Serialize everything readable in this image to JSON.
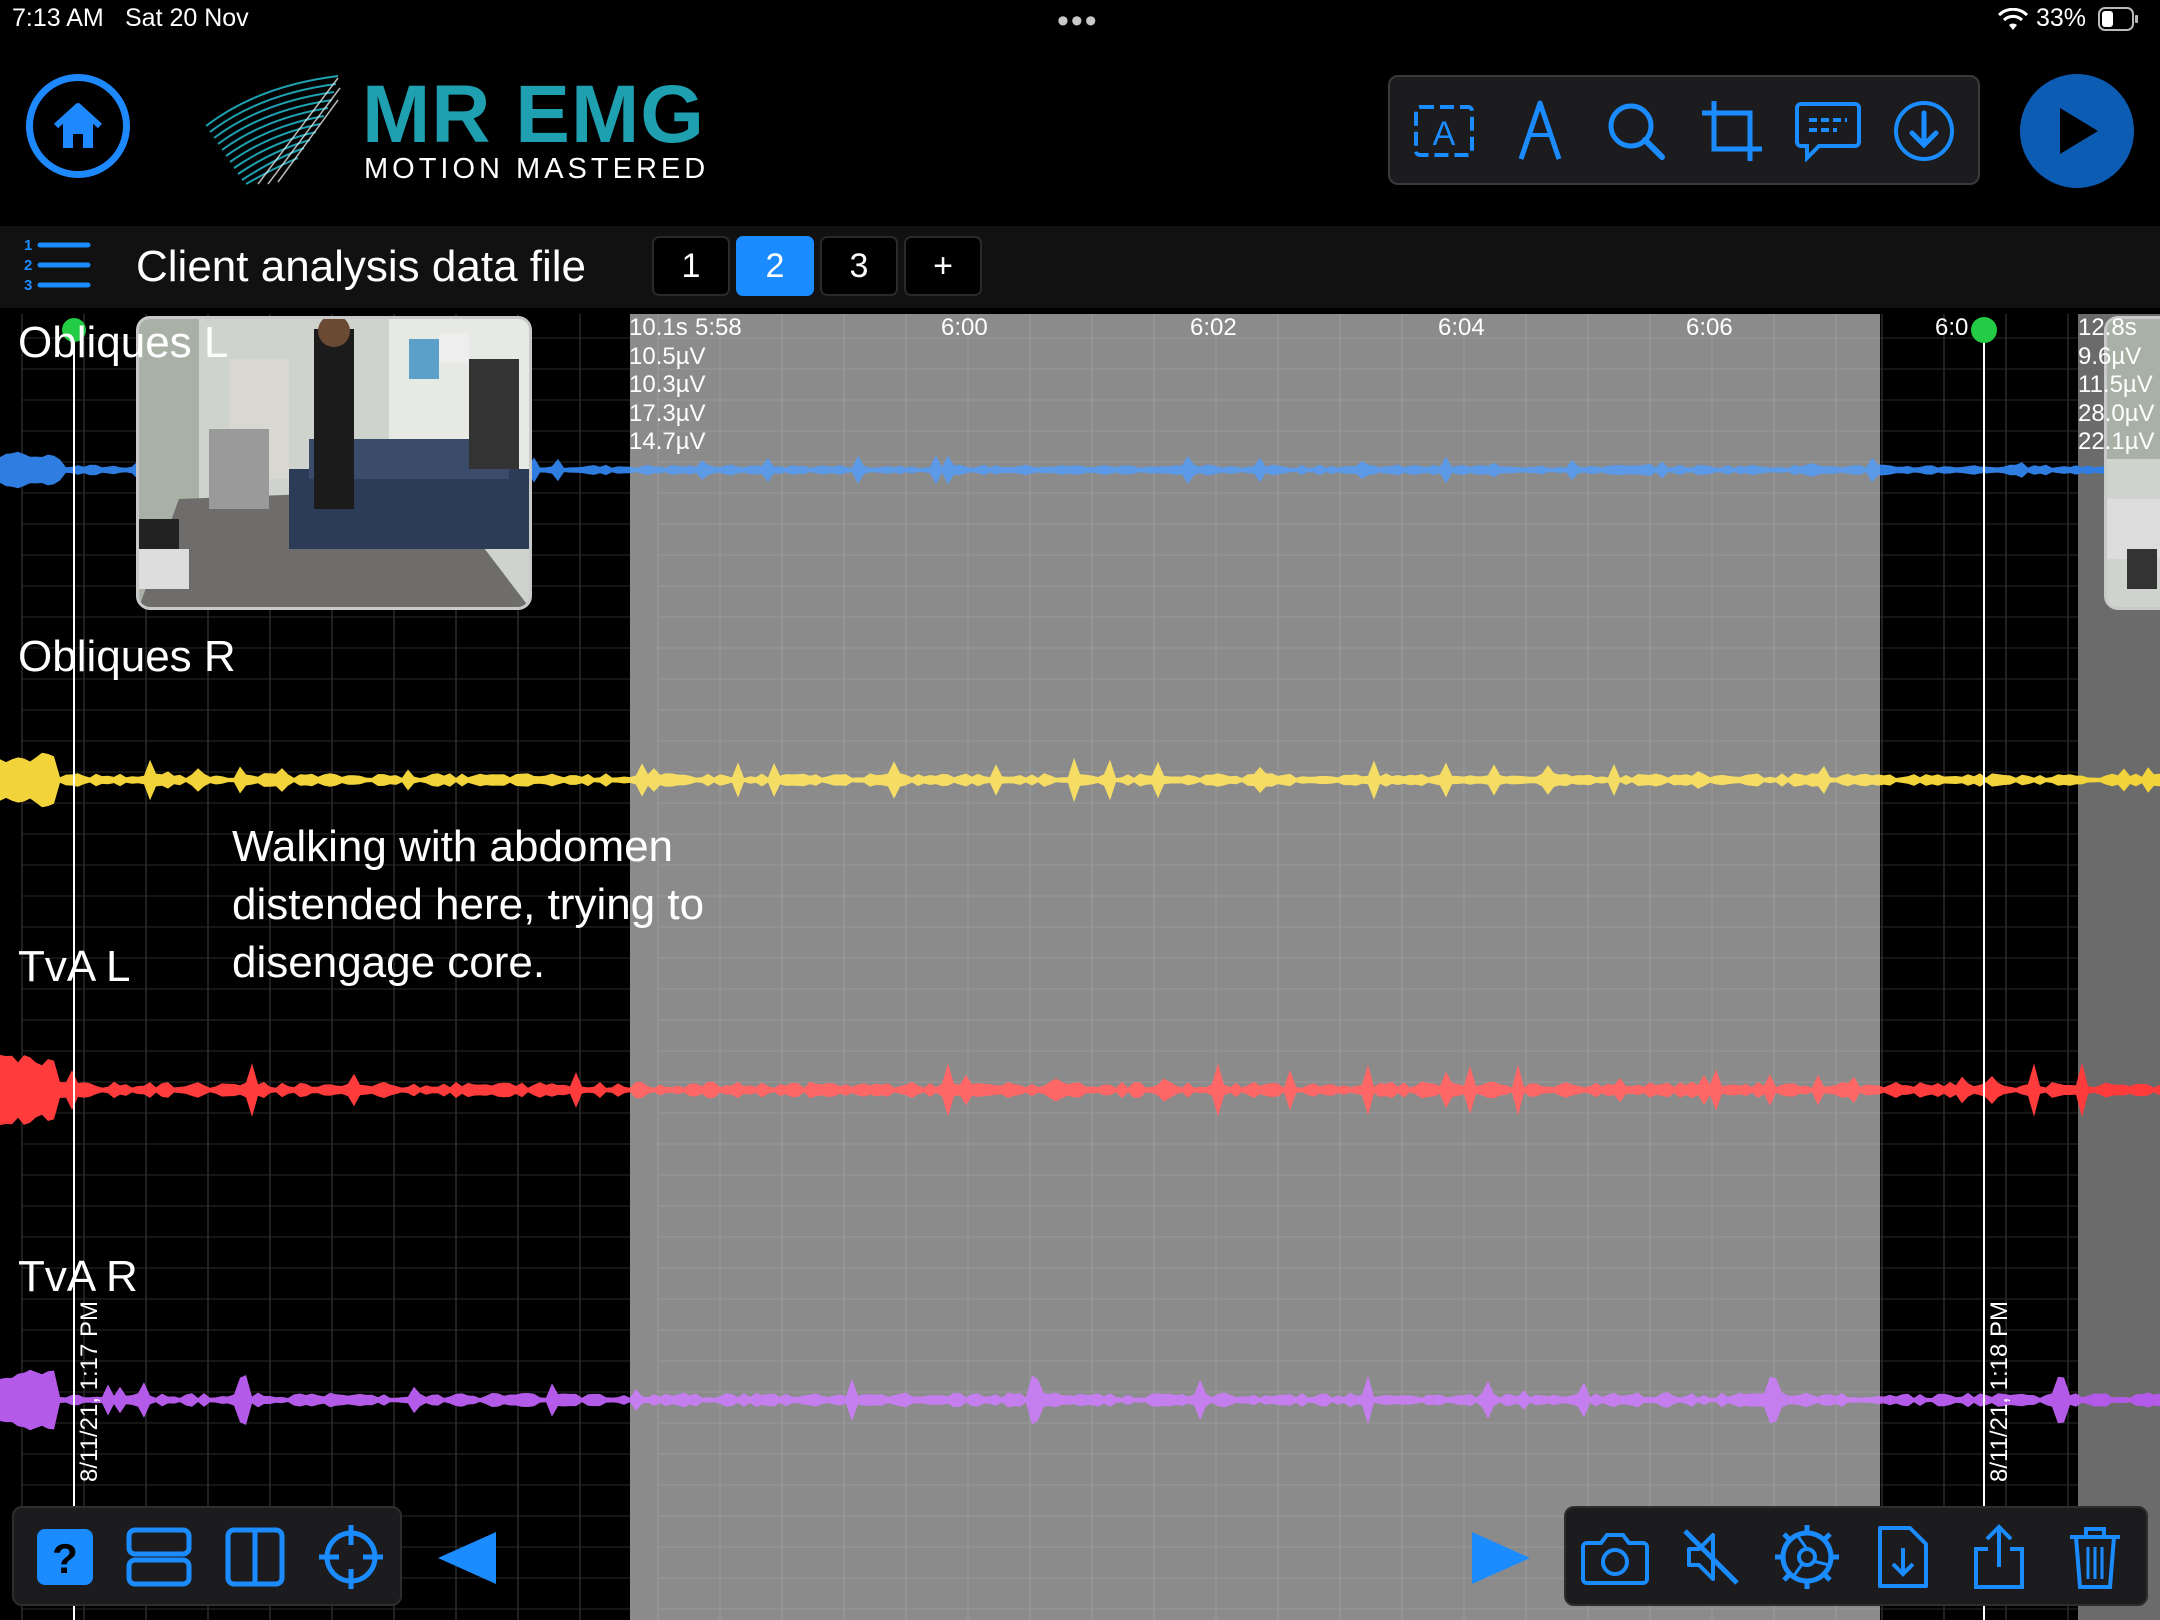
{
  "status_bar": {
    "time": "7:13 AM",
    "date": "Sat 20 Nov",
    "battery": "33%",
    "dots": "•••"
  },
  "brand": {
    "name": "MR EMG",
    "tagline": "MOTION MASTERED"
  },
  "header_tools": [
    "text-box-icon",
    "pen-icon",
    "search-icon",
    "crop-icon",
    "comment-icon",
    "download-icon"
  ],
  "file": {
    "title": "Client analysis data file",
    "pages": [
      "1",
      "2",
      "3",
      "+"
    ],
    "active_page": "2"
  },
  "channels": [
    {
      "name": "Obliques L",
      "color": "#2f7de1"
    },
    {
      "name": "Obliques R",
      "color": "#f2d33a"
    },
    {
      "name": "TvA L",
      "color": "#ff3b3b"
    },
    {
      "name": "TvA R",
      "color": "#b45ae8"
    }
  ],
  "readout_left": {
    "duration": "10.1s",
    "values": [
      "10.5µV",
      "10.3µV",
      "17.3µV",
      "14.7µV"
    ]
  },
  "readout_right": {
    "duration": "12.8s",
    "values": [
      "9.6µV",
      "11.5µV",
      "28.0µV",
      "22.1µV"
    ]
  },
  "time_ticks": [
    "5:58",
    "6:00",
    "6:02",
    "6:04",
    "6:06",
    "6:0"
  ],
  "timestamps": {
    "left": "8/11/21, 1:17 PM",
    "right": "8/11/21, 1:18 PM"
  },
  "annotation": "Walking with abdomen distended here, trying to disengage core.",
  "bottom_left_tools": [
    "help-icon",
    "stacked-view-icon",
    "split-view-icon",
    "crosshair-icon"
  ],
  "bottom_right_tools": [
    "camera-icon",
    "mute-icon",
    "settings-icon",
    "import-icon",
    "share-icon",
    "trash-icon"
  ],
  "colors": {
    "accent": "#1a8cff",
    "brand": "#1fa0b0",
    "selection": "#6b6b6b",
    "marker": "#22cc44"
  }
}
